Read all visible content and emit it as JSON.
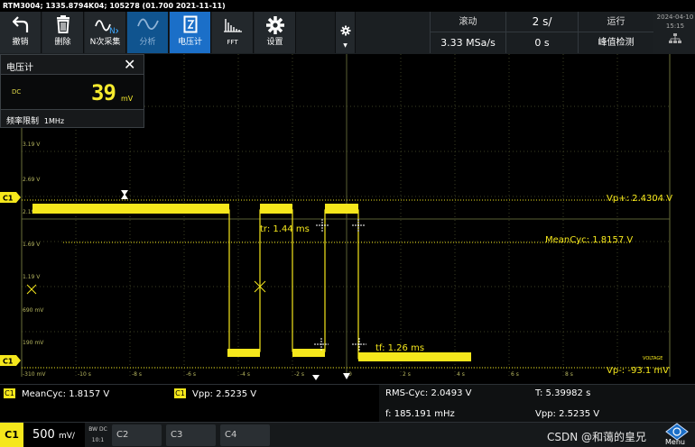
{
  "title": "RTM3004; 1335.8794K04; 105278 (01.700 2021-11-11)",
  "toolbar": {
    "undo": "撤销",
    "delete": "删除",
    "nx_acq": "N次采集",
    "nx_icon_text": "Nx",
    "analyze": "分析",
    "voltmeter": "电压计",
    "fft": "FFT",
    "settings": "设置"
  },
  "acquisition": {
    "mode": "滚动",
    "sample_rate": "3.33 MSa/s",
    "timebase": "2 s/",
    "position": "0 s",
    "run_state": "运行",
    "detect": "峰值检测",
    "date": "2024-04-10",
    "time": "15:15"
  },
  "dvm": {
    "title": "电压计",
    "close": "✕",
    "mode": "DC",
    "value": "39",
    "unit": "mV",
    "filter_label": "频率限制",
    "filter_value": "1MHz"
  },
  "plot": {
    "ch_marker": "C1",
    "y_labels": [
      "3.19 V",
      "2.69 V",
      "2.19 V",
      "1.69 V",
      "1.19 V",
      "690 mV",
      "190 mV",
      "-310 mV"
    ],
    "x_labels": [
      "-10 s",
      "-8 s",
      "-6 s",
      "-4 s",
      "-2 s",
      "0",
      "2 s",
      "4 s",
      "6 s",
      "8 s"
    ],
    "annotations": {
      "vp_plus": "Vp+: 2.4304 V",
      "meancyc": "MeanCyc: 1.8157 V",
      "vp_minus": "Vp-: -93.1 mV",
      "tr": "tr: 1.44 ms",
      "tf": "tf: 1.26 ms",
      "voltage_tag": "VOLTAGE"
    },
    "colors": {
      "trace": "#f5e71c",
      "grid": "#5a5f30",
      "grid_line": "#3b3f22"
    }
  },
  "measurements": {
    "ch": "C1",
    "meancyc": "MeanCyc: 1.8157 V",
    "vpp": "Vpp: 2.5235 V",
    "rms_cyc": "RMS-Cyc: 2.0493 V",
    "period": "T: 5.39982 s",
    "freq": "f: 185.191 mHz",
    "vpp2": "Vpp: 2.5235 V"
  },
  "channels": {
    "c1": "C1",
    "c1_scale": "500",
    "c1_unit": "mV/",
    "bw_label": "BW DC",
    "attenuation": "10:1",
    "c2": "C2",
    "c3": "C3",
    "c4": "C4"
  },
  "watermark": "CSDN @和蔼的皇兄",
  "menu_label": "Menu"
}
